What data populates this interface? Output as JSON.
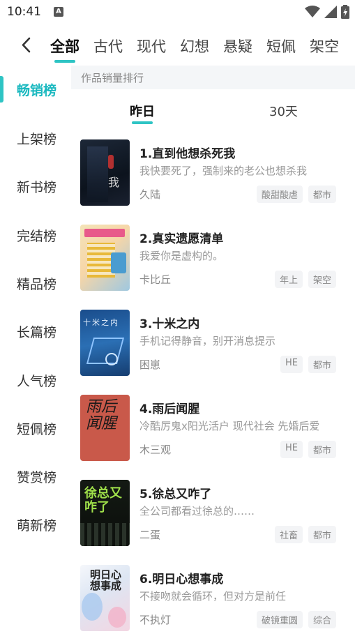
{
  "status_bar": {
    "time": "10:41",
    "app_icon_letter": "A"
  },
  "top_tabs": [
    "全部",
    "古代",
    "现代",
    "幻想",
    "悬疑",
    "短佩",
    "架空"
  ],
  "active_tab_index": 0,
  "sidebar": {
    "items": [
      "畅销榜",
      "上架榜",
      "新书榜",
      "完结榜",
      "精品榜",
      "长篇榜",
      "人气榜",
      "短佩榜",
      "赞赏榜",
      "萌新榜"
    ],
    "active_index": 0
  },
  "ranking": {
    "section_title": "作品销量排行",
    "periods": [
      "昨日",
      "30天"
    ],
    "active_period_index": 0
  },
  "books": [
    {
      "title": "1.直到他想杀死我",
      "desc": "我快要死了，强制来的老公也想杀我",
      "author": "久陆",
      "tags": [
        "酸甜酸虐",
        "都市"
      ],
      "cover_text": "我"
    },
    {
      "title": "2.真实遗愿清单",
      "desc": "我爱你是虚构的。",
      "author": "卡比丘",
      "tags": [
        "年上",
        "架空"
      ],
      "cover_text": ""
    },
    {
      "title": "3.十米之内",
      "desc": "手机记得静音，别开消息提示",
      "author": "困崽",
      "tags": [
        "HE",
        "都市"
      ],
      "cover_text": "十米之内"
    },
    {
      "title": "4.雨后闻腥",
      "desc": "冷酷厉鬼x阳光活户 现代社会 先婚后爱",
      "author": "木三观",
      "tags": [
        "HE",
        "都市"
      ],
      "cover_text": "雨后闻腥"
    },
    {
      "title": "5.徐总又咋了",
      "desc": "全公司都看过徐总的……",
      "author": "二蛋",
      "tags": [
        "社畜",
        "都市"
      ],
      "cover_text": "徐总又咋了"
    },
    {
      "title": "6.明日心想事成",
      "desc": "不接吻就会循环，但对方是前任",
      "author": "不执灯",
      "tags": [
        "破镜重圆",
        "综合"
      ],
      "cover_text": "明日心想事成"
    }
  ],
  "colors": {
    "accent": "#2ec4c4",
    "active_side": "#19b8bf"
  },
  "icons": {
    "back": "chevron-left-icon",
    "wifi": "wifi-icon",
    "signal": "signal-icon",
    "battery": "battery-icon"
  }
}
